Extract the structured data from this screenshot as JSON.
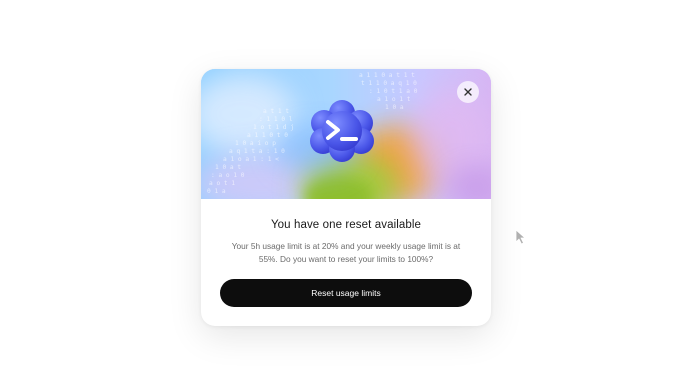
{
  "dialog": {
    "title": "You have one reset available",
    "description": "Your 5h usage limit is at 20% and your weekly usage limit is at 55%. Do you want to reset your limits to 100%?",
    "primary_button_label": "Reset usage limits",
    "close_icon": "close-icon",
    "hero_icon": "terminal-prompt-icon"
  },
  "usage": {
    "five_hour_percent": 20,
    "weekly_percent": 55,
    "reset_target_percent": 100
  },
  "colors": {
    "button_bg": "#0d0d0d",
    "button_text": "#ffffff",
    "icon_blue": "#4a56e8"
  }
}
